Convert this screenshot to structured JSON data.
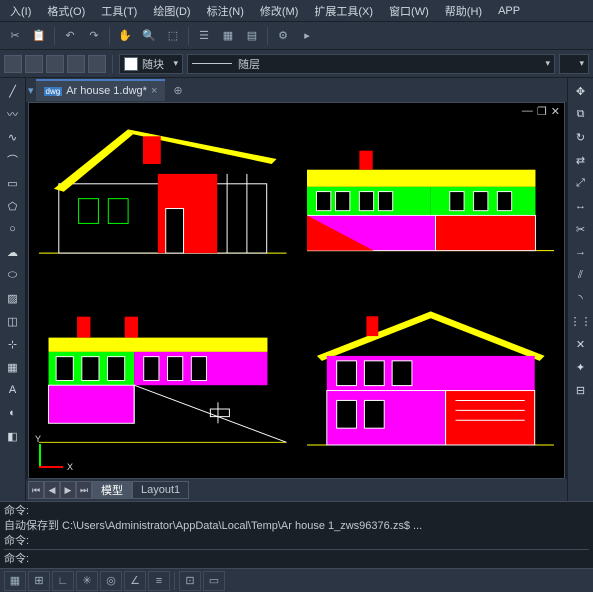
{
  "menu": {
    "insert": "入(I)",
    "format": "格式(O)",
    "tools": "工具(T)",
    "draw": "绘图(D)",
    "dimension": "标注(N)",
    "modify": "修改(M)",
    "ext": "扩展工具(X)",
    "window": "窗口(W)",
    "help": "帮助(H)",
    "app": "APP"
  },
  "props": {
    "byblock": "随块",
    "bylayer": "随层"
  },
  "tabs": {
    "file_icon": "dwg",
    "filename": "Ar house 1.dwg*",
    "model": "模型",
    "layout1": "Layout1"
  },
  "ucs": {
    "y": "Y",
    "x": "X"
  },
  "cmd": {
    "prompt1": "命令:",
    "line2": "自动保存到 C:\\Users\\Administrator\\AppData\\Local\\Temp\\Ar house 1_zws96376.zs$ ...",
    "prompt3": "命令:",
    "inputlabel": "命令:"
  }
}
